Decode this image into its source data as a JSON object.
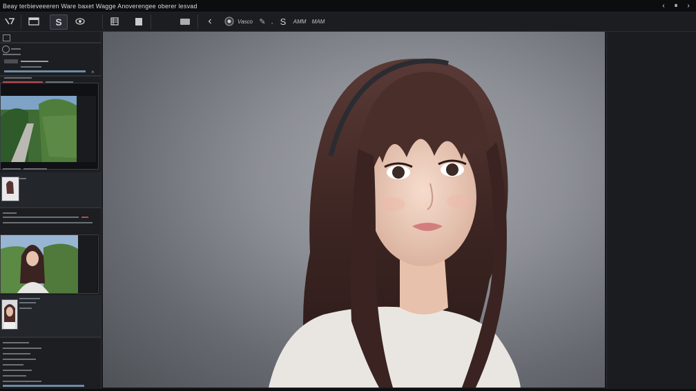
{
  "window": {
    "title": "Beay terbieveeeren Ware baxet  Wagge Anoverengee oberer lesvad",
    "controls": [
      "‹",
      "⏸",
      "›"
    ]
  },
  "toolbar": {
    "tools": [
      {
        "name": "move-tool-icon",
        "glyph": "⟨/"
      },
      {
        "name": "layers-icon",
        "glyph": "▤"
      },
      {
        "name": "brush-S-icon",
        "glyph": "S"
      },
      {
        "name": "eye-icon",
        "glyph": "◉"
      },
      {
        "name": "grid-icon",
        "glyph": "▦"
      },
      {
        "name": "square-icon",
        "glyph": "■"
      },
      {
        "name": "frame-icon",
        "glyph": "▭"
      },
      {
        "name": "back-icon",
        "glyph": "‹"
      }
    ],
    "view_label": "Vasco",
    "pen_glyph": "✎",
    "slash": ",",
    "s_glyph": "S",
    "text_a": "AMM",
    "text_b": "MAM"
  },
  "leftpanel": {
    "header_icon": "panel-icon"
  }
}
